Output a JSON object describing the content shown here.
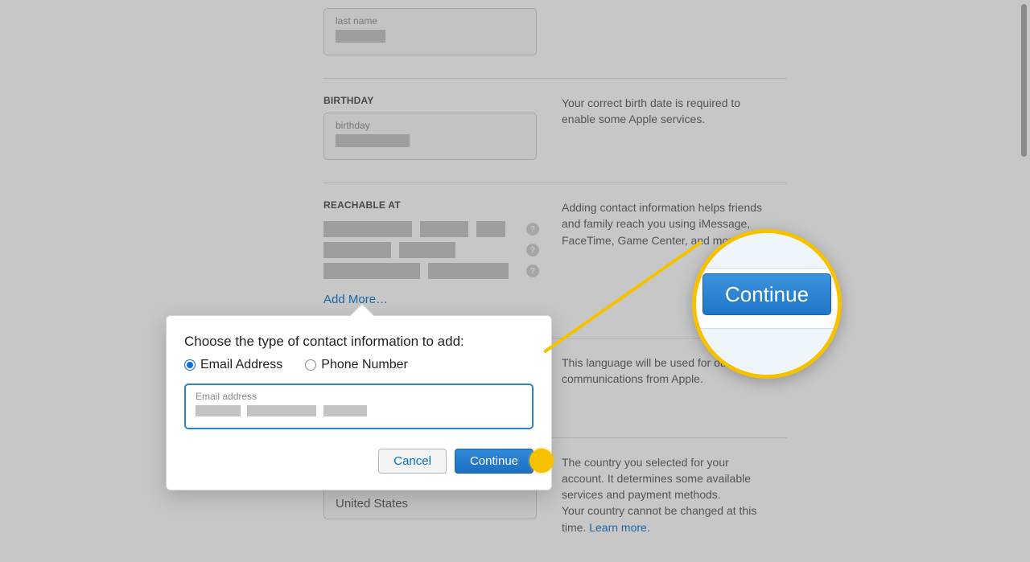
{
  "form": {
    "lastname_label": "last name",
    "birthday_heading": "BIRTHDAY",
    "birthday_label": "birthday",
    "birthday_help": "Your correct birth date is required to enable some Apple services.",
    "reachable_heading": "REACHABLE AT",
    "reachable_help": "Adding contact information helps friends and family reach you using iMessage, FaceTime, Game Center, and more.",
    "add_more": "Add More…",
    "language_help": "This language will be used for other communications from Apple.",
    "country_value": "United States",
    "country_help_1": "The country you selected for your account. It determines some available services and payment methods.",
    "country_help_2": "Your country cannot be changed at this time. ",
    "learn_more": "Learn more."
  },
  "popover": {
    "title": "Choose the type of contact information to add:",
    "option_email": "Email Address",
    "option_phone": "Phone Number",
    "email_field_label": "Email address",
    "cancel": "Cancel",
    "continue": "Continue"
  },
  "magnifier": {
    "continue": "Continue"
  }
}
